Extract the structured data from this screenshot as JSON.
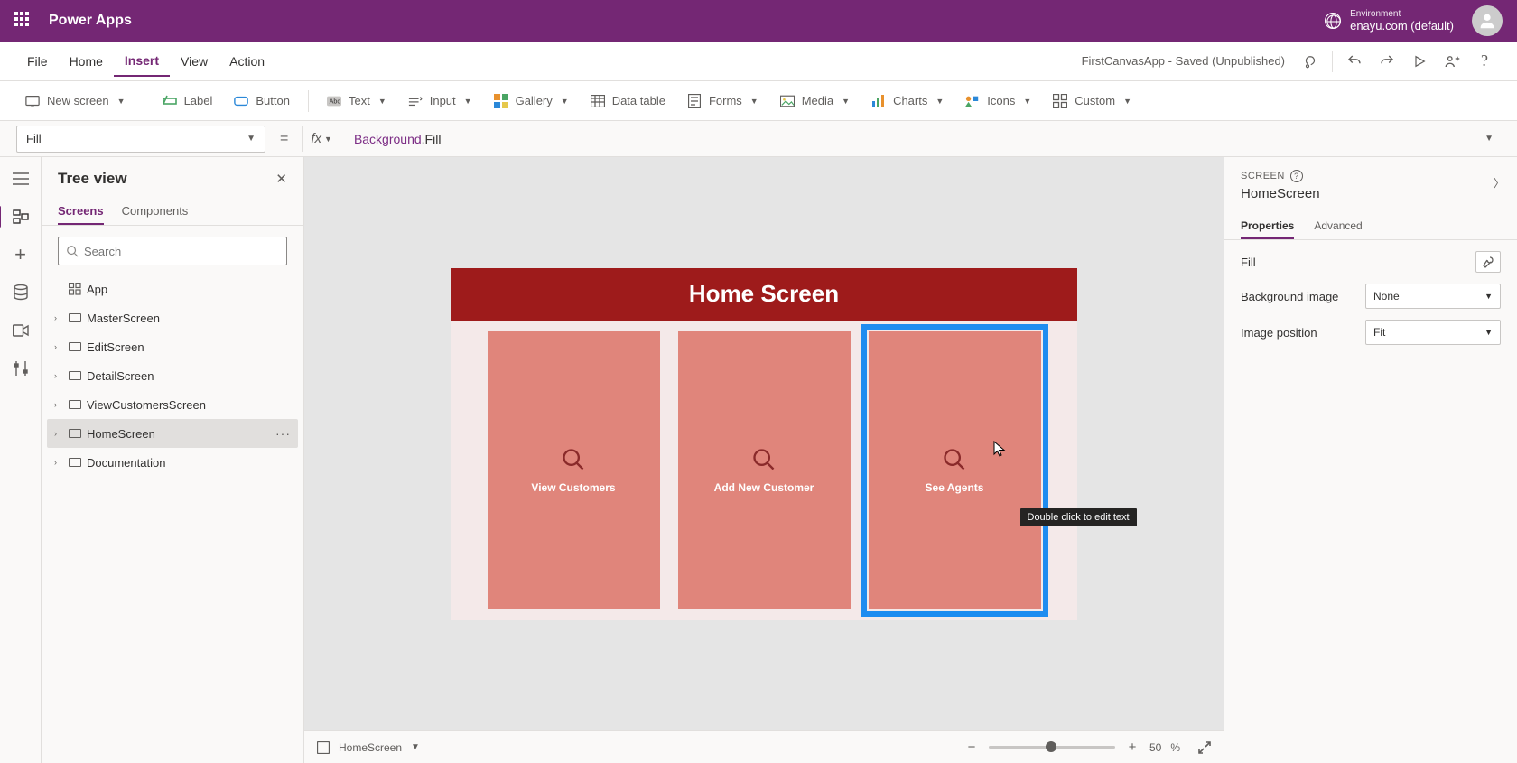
{
  "header": {
    "app_title": "Power Apps",
    "env_label": "Environment",
    "env_value": "enayu.com (default)"
  },
  "menubar": {
    "items": [
      "File",
      "Home",
      "Insert",
      "View",
      "Action"
    ],
    "active_index": 2,
    "document_status": "FirstCanvasApp - Saved (Unpublished)"
  },
  "ribbon": {
    "new_screen": "New screen",
    "label": "Label",
    "button": "Button",
    "text": "Text",
    "input": "Input",
    "gallery": "Gallery",
    "data_table": "Data table",
    "forms": "Forms",
    "media": "Media",
    "charts": "Charts",
    "icons": "Icons",
    "custom": "Custom"
  },
  "formula": {
    "property": "Fill",
    "fx_label": "fx",
    "object": "Background",
    "prop_suffix": ".Fill"
  },
  "tree": {
    "title": "Tree view",
    "tabs": {
      "screens": "Screens",
      "components": "Components"
    },
    "search_placeholder": "Search",
    "app_label": "App",
    "items": [
      {
        "label": "MasterScreen"
      },
      {
        "label": "EditScreen"
      },
      {
        "label": "DetailScreen"
      },
      {
        "label": "ViewCustomersScreen"
      },
      {
        "label": "HomeScreen",
        "selected": true
      },
      {
        "label": "Documentation"
      }
    ]
  },
  "canvas": {
    "screen_title": "Home Screen",
    "cards": [
      {
        "label": "View Customers"
      },
      {
        "label": "Add New Customer"
      },
      {
        "label": "See Agents",
        "selected": true
      }
    ],
    "edit_tooltip": "Double click to edit text"
  },
  "rightpanel": {
    "type_label": "SCREEN",
    "name": "HomeScreen",
    "tabs": {
      "properties": "Properties",
      "advanced": "Advanced"
    },
    "props": {
      "fill_label": "Fill",
      "bg_image_label": "Background image",
      "bg_image_value": "None",
      "img_pos_label": "Image position",
      "img_pos_value": "Fit"
    }
  },
  "bottombar": {
    "screen_label": "HomeScreen",
    "zoom_value": "50",
    "zoom_unit": "%"
  }
}
